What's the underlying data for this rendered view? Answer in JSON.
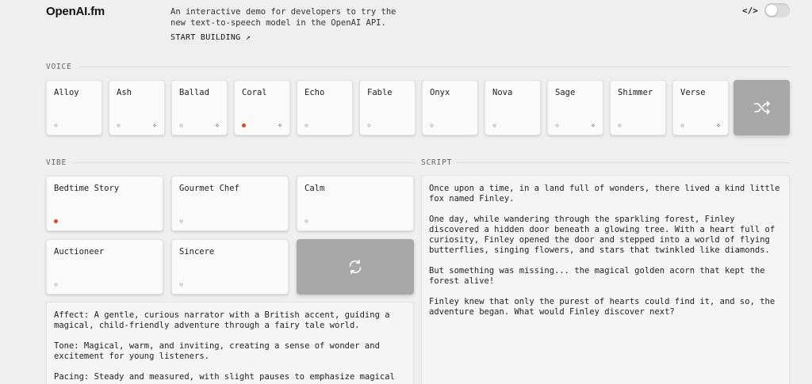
{
  "brand": "OpenAI.fm",
  "tagline": "An interactive demo for developers to try the new text-to-speech model in the OpenAI API.",
  "start_building": "START BUILDING ↗",
  "code_icon": "</>",
  "dev_toggle": {
    "on": false
  },
  "voice": {
    "label": "VOICE",
    "items": [
      {
        "name": "Alloy",
        "selected": false,
        "sparkle": false
      },
      {
        "name": "Ash",
        "selected": false,
        "sparkle": true
      },
      {
        "name": "Ballad",
        "selected": false,
        "sparkle": true
      },
      {
        "name": "Coral",
        "selected": true,
        "sparkle": true
      },
      {
        "name": "Echo",
        "selected": false,
        "sparkle": false
      },
      {
        "name": "Fable",
        "selected": false,
        "sparkle": false
      },
      {
        "name": "Onyx",
        "selected": false,
        "sparkle": false
      },
      {
        "name": "Nova",
        "selected": false,
        "sparkle": false
      },
      {
        "name": "Sage",
        "selected": false,
        "sparkle": true
      },
      {
        "name": "Shimmer",
        "selected": false,
        "sparkle": false
      },
      {
        "name": "Verse",
        "selected": false,
        "sparkle": true
      }
    ],
    "shuffle_icon": "shuffle-icon"
  },
  "vibe": {
    "label": "VIBE",
    "items": [
      {
        "name": "Bedtime Story",
        "selected": true
      },
      {
        "name": "Gourmet Chef",
        "selected": false
      },
      {
        "name": "Calm",
        "selected": false
      },
      {
        "name": "Auctioneer",
        "selected": false
      },
      {
        "name": "Sincere",
        "selected": false
      }
    ],
    "refresh_icon": "refresh-icon",
    "description": "Affect: A gentle, curious narrator with a British accent, guiding a magical, child-friendly adventure through a fairy tale world.\n\nTone: Magical, warm, and inviting, creating a sense of wonder and excitement for young listeners.\n\nPacing: Steady and measured, with slight pauses to emphasize magical"
  },
  "script": {
    "label": "SCRIPT",
    "text": "Once upon a time, in a land full of wonders, there lived a kind little fox named Finley.\n\nOne day, while wandering through the sparkling forest, Finley discovered a hidden door beneath a glowing tree. With a heart full of curiosity, Finley opened the door and stepped into a world of flying butterflies, singing flowers, and stars that twinkled like diamonds.\n\nBut something was missing... the magical golden acorn that kept the forest alive!\n\nFinley knew that only the purest of hearts could find it, and so, the adventure began. What would Finley discover next?"
  },
  "colors": {
    "accent": "#e0491e",
    "action": "#a8a8a8",
    "background": "#efefef"
  }
}
